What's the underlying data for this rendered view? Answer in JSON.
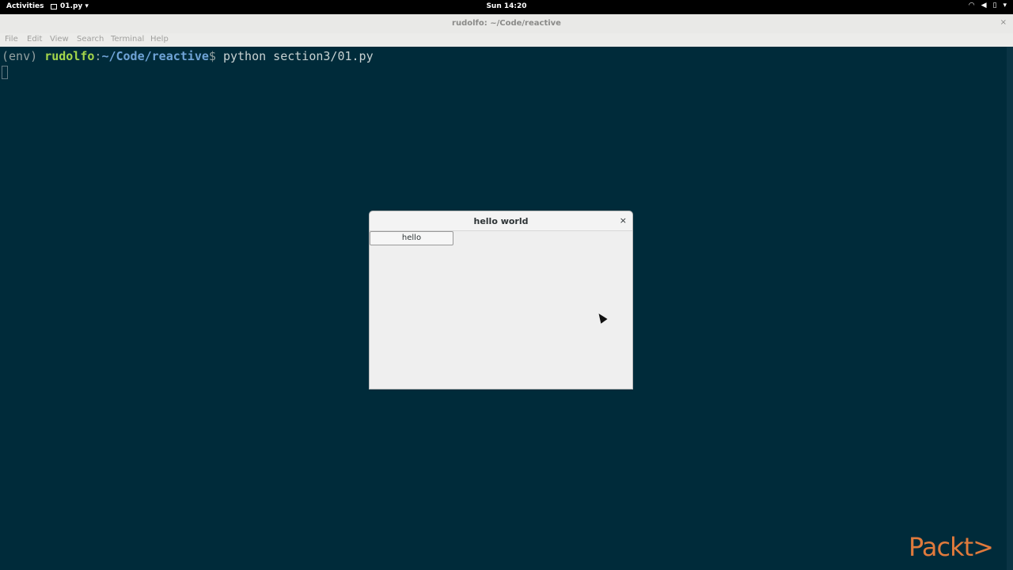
{
  "topbar": {
    "activities": "Activities",
    "app_menu": "01.py ▾",
    "clock": "Sun 14:20",
    "status_icons": [
      "wifi-icon",
      "volume-icon",
      "battery-icon",
      "menu-arrow-icon"
    ]
  },
  "window": {
    "title": "rudolfo: ~/Code/reactive",
    "close": "×"
  },
  "menubar": {
    "items": [
      "File",
      "Edit",
      "View",
      "Search",
      "Terminal",
      "Help"
    ]
  },
  "terminal": {
    "env": "(env) ",
    "user": "rudolfo",
    "colon": ":",
    "path": "~/Code/reactive",
    "dollar": "$ ",
    "command": "python section3/01.py"
  },
  "dialog": {
    "title": "hello world",
    "close": "×",
    "button_label": "hello"
  },
  "brand": {
    "logo": "Packt>"
  },
  "colors": {
    "terminal_bg": "#002b3a",
    "user": "#a4d64b",
    "path": "#6fa3d6",
    "logo": "#e07a3c"
  }
}
